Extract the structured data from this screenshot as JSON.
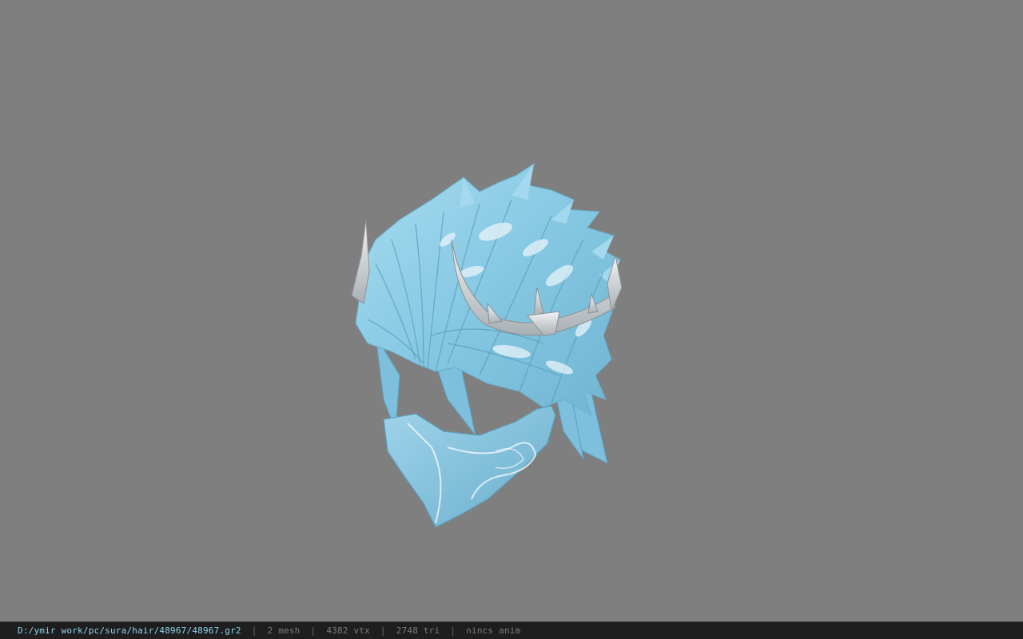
{
  "viewer": {
    "background_color": "#7f7f7f",
    "model": {
      "subject": "hair-model",
      "base_color": "#8ccde6",
      "highlight_color": "#e8f4fa",
      "accessory_color": "#d9dde0"
    }
  },
  "status_bar": {
    "file_path": "D:/ymir work/pc/sura/hair/48967/48967.gr2",
    "separator": "|",
    "mesh_count": "2 mesh",
    "vertex_count": "4382 vtx",
    "triangle_count": "2748 tri",
    "animation": "nincs anim",
    "path_color": "#8fd3ee",
    "text_color": "#7d7d7d"
  }
}
